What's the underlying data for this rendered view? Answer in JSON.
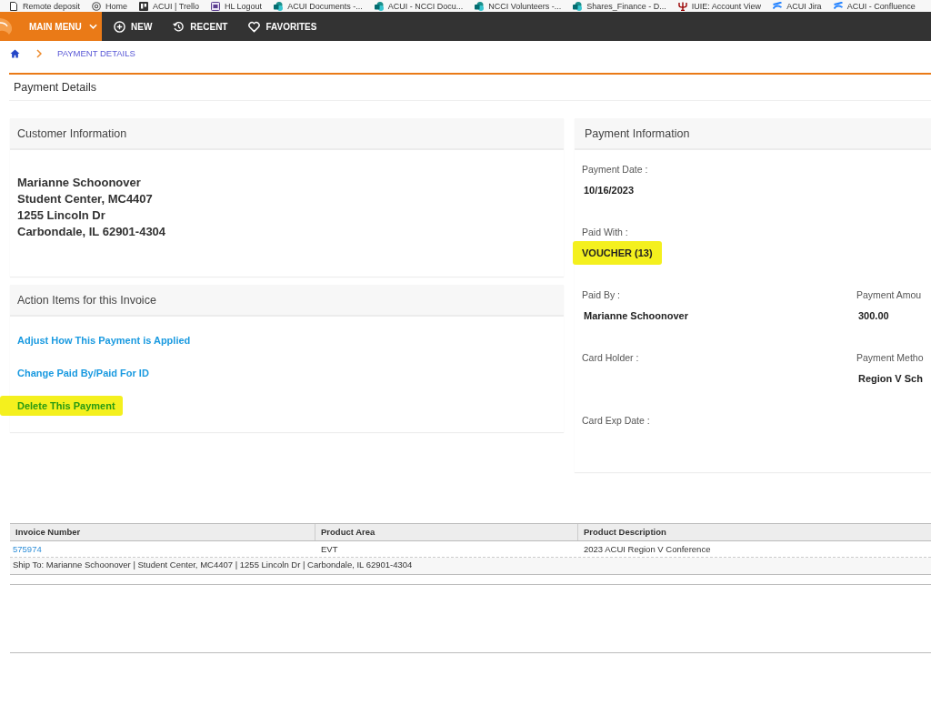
{
  "bookmarks_bar": [
    {
      "label": "Remote deposit",
      "kind": "page"
    },
    {
      "label": "Home",
      "kind": "at"
    },
    {
      "label": "ACUI | Trello",
      "kind": "board"
    },
    {
      "label": "HL Logout",
      "kind": "app"
    },
    {
      "label": "ACUI Documents -...",
      "kind": "circles"
    },
    {
      "label": "ACUI - NCCI Docu...",
      "kind": "circles"
    },
    {
      "label": "NCCI Volunteers -...",
      "kind": "circles"
    },
    {
      "label": "Shares_Finance - D...",
      "kind": "circles"
    },
    {
      "label": "IUIE: Account View",
      "kind": "trident"
    },
    {
      "label": "ACUI Jira",
      "kind": "wave"
    },
    {
      "label": "ACUI - Confluence",
      "kind": "wave"
    }
  ],
  "nav_bar": [
    {
      "label": "MAIN MENU",
      "kind": "main_menu"
    },
    {
      "label": "NEW",
      "kind": "new"
    },
    {
      "label": "RECENT",
      "kind": "recent"
    },
    {
      "label": "FAVORITES",
      "kind": "favorites"
    }
  ],
  "breadcrumb": {
    "current": "PAYMENT DETAILS"
  },
  "page_title": "Payment Details",
  "customer_information": {
    "title": "Customer Information",
    "address_lines": [
      "Marianne Schoonover",
      "Student Center, MC4407",
      "1255 Lincoln Dr",
      "Carbondale, IL 62901-4304"
    ]
  },
  "action_items": {
    "title": "Action Items for this Invoice",
    "links": [
      {
        "label": "Adjust How This Payment is Applied",
        "highlighted": false
      },
      {
        "label": "Change Paid By/Paid For ID",
        "highlighted": false
      },
      {
        "label": "Delete This Payment",
        "highlighted": true
      }
    ]
  },
  "payment_information": {
    "title": "Payment Information",
    "rows": [
      [
        {
          "label": "Payment Date :",
          "value": "10/16/2023",
          "highlighted": false
        }
      ],
      [
        {
          "label": "Paid With :",
          "value": "VOUCHER (13)",
          "highlighted": true
        }
      ],
      [
        {
          "label": "Paid By :",
          "value": "Marianne Schoonover",
          "highlighted": false
        },
        {
          "label": "Payment Amou",
          "value": "300.00",
          "highlighted": false
        }
      ],
      [
        {
          "label": "Card Holder :"
        },
        {
          "label": "Payment Metho",
          "value": "Region V Sch",
          "highlighted": false
        }
      ],
      [
        {
          "label": "Card Exp Date :"
        }
      ]
    ]
  },
  "invoice_table": {
    "columns": [
      "Invoice Number",
      "Product Area",
      "Product Description"
    ],
    "rows": [
      {
        "cells": [
          "575974",
          "EVT",
          "2023 ACUI Region V Conference"
        ],
        "ship_to": "Ship To:  Marianne Schoonover | Student Center, MC4407 | 1255 Lincoln Dr | Carbondale, IL 62901-4304"
      }
    ]
  }
}
